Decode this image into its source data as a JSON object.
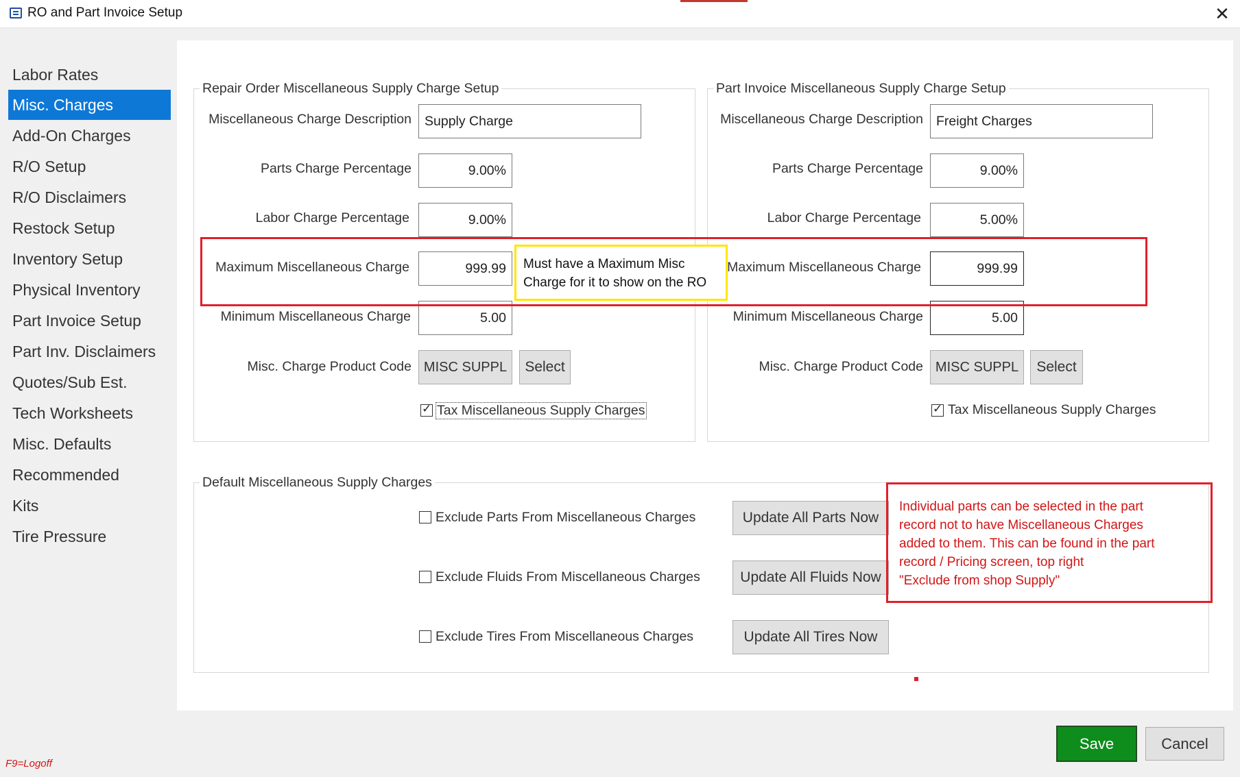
{
  "window": {
    "title": "RO and Part Invoice Setup",
    "close_glyph": "✕"
  },
  "sidebar": {
    "items": [
      {
        "label": "Labor Rates"
      },
      {
        "label": "Misc. Charges",
        "active": true
      },
      {
        "label": "Add-On Charges"
      },
      {
        "label": "R/O Setup"
      },
      {
        "label": "R/O Disclaimers"
      },
      {
        "label": "Restock Setup"
      },
      {
        "label": "Inventory Setup"
      },
      {
        "label": "Physical Inventory"
      },
      {
        "label": "Part Invoice Setup"
      },
      {
        "label": "Part Inv. Disclaimers"
      },
      {
        "label": "Quotes/Sub Est."
      },
      {
        "label": "Tech Worksheets"
      },
      {
        "label": "Misc. Defaults"
      },
      {
        "label": "Recommended"
      },
      {
        "label": "Kits"
      },
      {
        "label": "Tire Pressure"
      }
    ],
    "footer_hint": "F9=Logoff"
  },
  "ro_setup": {
    "title": "Repair Order Miscellaneous Supply Charge Setup",
    "desc_label": "Miscellaneous Charge Description",
    "desc_value": "Supply Charge",
    "parts_pct_label": "Parts Charge Percentage",
    "parts_pct_value": "9.00%",
    "labor_pct_label": "Labor Charge Percentage",
    "labor_pct_value": "9.00%",
    "max_label": "Maximum Miscellaneous Charge",
    "max_value": "999.99",
    "min_label": "Minimum Miscellaneous Charge",
    "min_value": "5.00",
    "product_code_label": "Misc. Charge Product Code",
    "product_code_value": "MISC SUPPL",
    "select_label": "Select",
    "tax_label": "Tax Miscellaneous Supply Charges",
    "tax_checked": true
  },
  "pi_setup": {
    "title": "Part Invoice Miscellaneous Supply Charge Setup",
    "desc_label": "Miscellaneous Charge Description",
    "desc_value": "Freight Charges",
    "parts_pct_label": "Parts Charge Percentage",
    "parts_pct_value": "9.00%",
    "labor_pct_label": "Labor Charge Percentage",
    "labor_pct_value": "5.00%",
    "max_label": "Maximum Miscellaneous Charge",
    "max_value": "999.99",
    "min_label": "Minimum Miscellaneous Charge",
    "min_value": "5.00",
    "product_code_label": "Misc. Charge Product Code",
    "product_code_value": "MISC SUPPL",
    "select_label": "Select",
    "tax_label": "Tax Miscellaneous Supply Charges",
    "tax_checked": true
  },
  "defaults": {
    "title": "Default Miscellaneous Supply Charges",
    "exclude_parts_label": "Exclude Parts From Miscellaneous Charges",
    "exclude_fluids_label": "Exclude Fluids From Miscellaneous Charges",
    "exclude_tires_label": "Exclude Tires From Miscellaneous Charges",
    "update_parts_label": "Update All Parts Now",
    "update_fluids_label": "Update All Fluids Now",
    "update_tires_label": "Update All Tires Now"
  },
  "annotations": {
    "yellow_note_line1": "Must have a Maximum Misc",
    "yellow_note_line2": "Charge for it to show on the RO",
    "red_note_line1": "Individual parts can be selected in the part",
    "red_note_line2": "record not to have Miscellaneous Charges",
    "red_note_line3": "added to them.  This can be found in the part",
    "red_note_line4": "record / Pricing screen, top right",
    "red_note_line5": "\"Exclude from shop Supply\""
  },
  "footer": {
    "save_label": "Save",
    "cancel_label": "Cancel"
  },
  "colors": {
    "accent": "#0e78d7",
    "save_green": "#0e8d1c",
    "annotation_red": "#e0202a",
    "annotation_yellow": "#ffe600"
  }
}
